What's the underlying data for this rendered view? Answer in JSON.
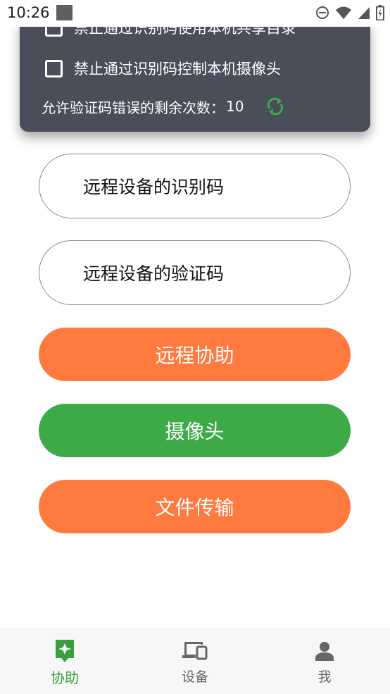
{
  "status_bar": {
    "time": "10:26"
  },
  "permissions": {
    "items": [
      {
        "label": "禁止通过识别码使用本机共享目录",
        "checked": false
      },
      {
        "label": "禁止通过识别码控制本机摄像头",
        "checked": false
      }
    ],
    "attempts_label": "允许验证码错误的剩余次数：",
    "attempts_value": "10"
  },
  "form": {
    "device_id_placeholder": "远程设备的识别码",
    "verify_code_placeholder": "远程设备的验证码"
  },
  "buttons": {
    "remote_assist": "远程协助",
    "camera": "摄像头",
    "file_transfer": "文件传输"
  },
  "nav": {
    "items": [
      {
        "label": "协助",
        "icon": "assist-icon",
        "active": true
      },
      {
        "label": "设备",
        "icon": "devices-icon",
        "active": false
      },
      {
        "label": "我",
        "icon": "person-icon",
        "active": false
      }
    ]
  },
  "colors": {
    "orange": "#ff7a3f",
    "green": "#3daa47",
    "card": "#4a4d5a",
    "active_nav": "#3a9f3e"
  }
}
